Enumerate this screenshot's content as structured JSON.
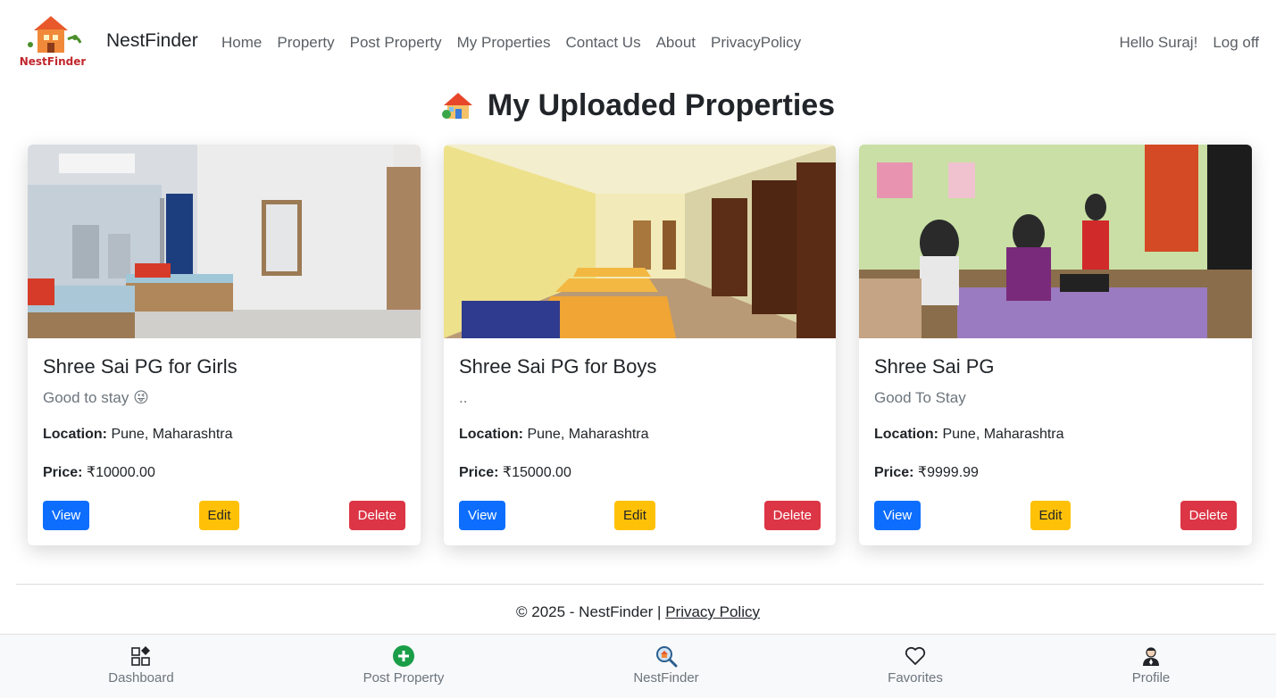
{
  "navbar": {
    "brand": "NestFinder",
    "logo_text": "NestFinder",
    "links": [
      "Home",
      "Property",
      "Post Property",
      "My Properties",
      "Contact Us",
      "About",
      "PrivacyPolicy"
    ],
    "greeting": "Hello Suraj!",
    "logout": "Log off"
  },
  "page": {
    "heading": "My Uploaded Properties",
    "heading_icon": "house-icon"
  },
  "properties": [
    {
      "title": "Shree Sai PG for Girls",
      "description": "Good to stay 😜",
      "location_label": "Location:",
      "location": "Pune, Maharashtra",
      "price_label": "Price:",
      "price": "₹10000.00",
      "view": "View",
      "edit": "Edit",
      "delete": "Delete"
    },
    {
      "title": "Shree Sai PG for Boys",
      "description": "..",
      "location_label": "Location:",
      "location": "Pune, Maharashtra",
      "price_label": "Price:",
      "price": "₹15000.00",
      "view": "View",
      "edit": "Edit",
      "delete": "Delete"
    },
    {
      "title": "Shree Sai PG",
      "description": "Good To Stay",
      "location_label": "Location:",
      "location": "Pune, Maharashtra",
      "price_label": "Price:",
      "price": "₹9999.99",
      "view": "View",
      "edit": "Edit",
      "delete": "Delete"
    }
  ],
  "footer": {
    "copyright": "© 2025 - NestFinder | ",
    "privacy_link": "Privacy Policy"
  },
  "bottom_nav": [
    {
      "label": "Dashboard",
      "icon": "dashboard-icon"
    },
    {
      "label": "Post Property",
      "icon": "plus-circle-icon"
    },
    {
      "label": "NestFinder",
      "icon": "search-house-icon"
    },
    {
      "label": "Favorites",
      "icon": "heart-icon"
    },
    {
      "label": "Profile",
      "icon": "user-icon"
    }
  ],
  "colors": {
    "primary": "#0d6efd",
    "warning": "#ffc107",
    "danger": "#dc3545",
    "success": "#1a9e48"
  }
}
